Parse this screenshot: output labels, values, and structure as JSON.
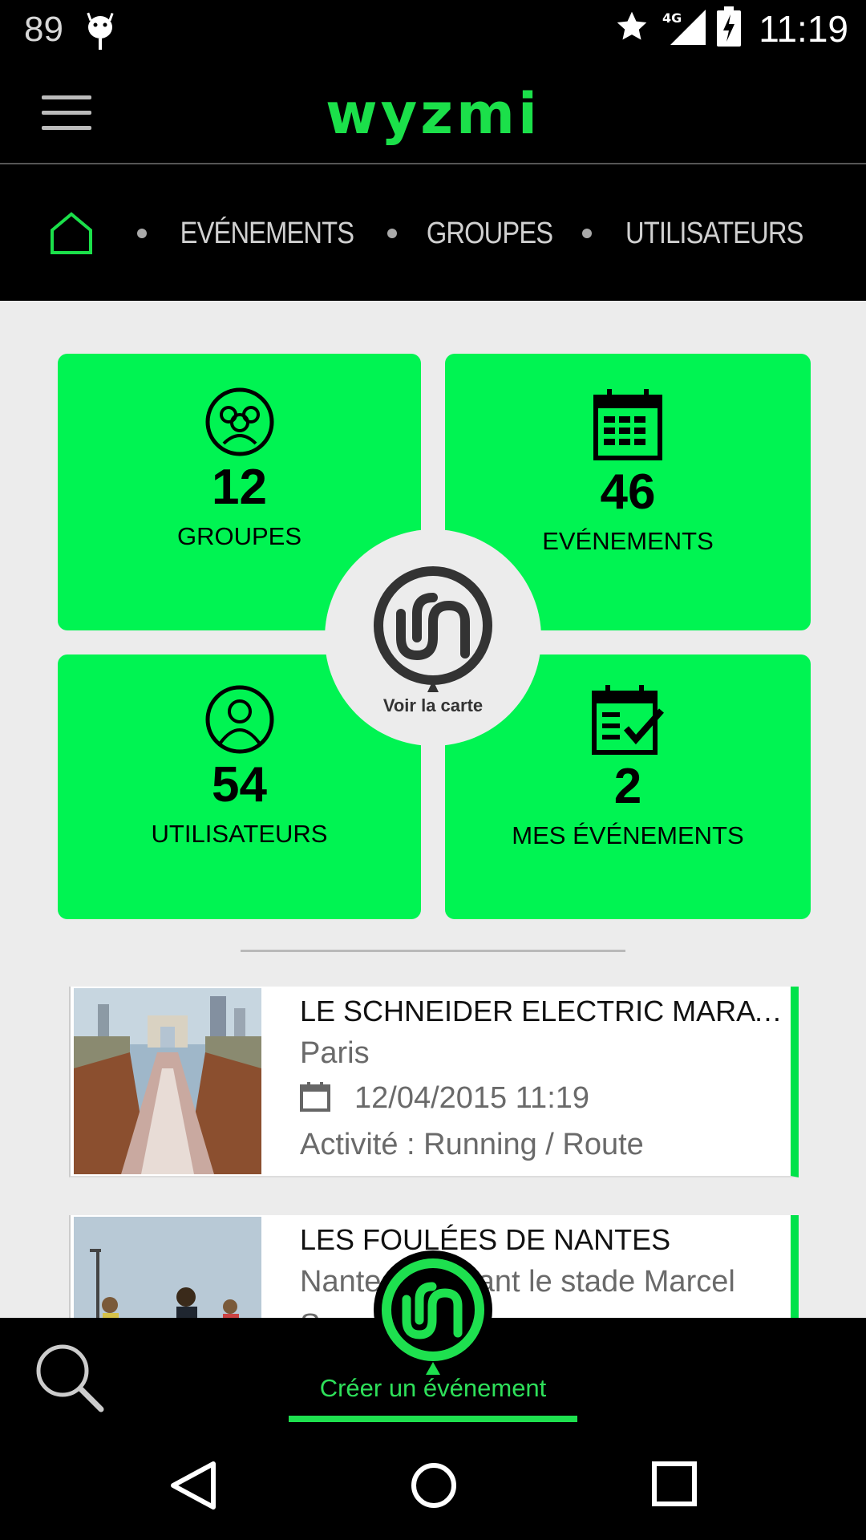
{
  "status_bar": {
    "left_text": "89",
    "time": "11:19",
    "network": "4G"
  },
  "app_bar": {
    "logo": "wyzmi"
  },
  "nav": {
    "items": [
      "EVÉNEMENTS",
      "GROUPES",
      "UTILISATEURS"
    ]
  },
  "tiles": [
    {
      "count": "12",
      "label": "GROUPES"
    },
    {
      "count": "46",
      "label": "EVÉNEMENTS"
    },
    {
      "count": "54",
      "label": "UTILISATEURS"
    },
    {
      "count": "2",
      "label": "MES ÉVÉNEMENTS"
    }
  ],
  "map": {
    "label": "Voir la carte"
  },
  "events": [
    {
      "title": "LE SCHNEIDER ELECTRIC MARATHON DE PARIS",
      "location": "Paris",
      "date": "12/04/2015 11:19",
      "activity": "Activité : Running / Route"
    },
    {
      "title": "LES FOULÉES DE NANTES",
      "location": "Nantes - Devant le stade Marcel",
      "location2": "Saup"
    }
  ],
  "bottom_bar": {
    "create_label": "Créer un événement"
  },
  "colors": {
    "accent": "#00f452",
    "logo": "#1be04a",
    "background": "#ececec"
  }
}
